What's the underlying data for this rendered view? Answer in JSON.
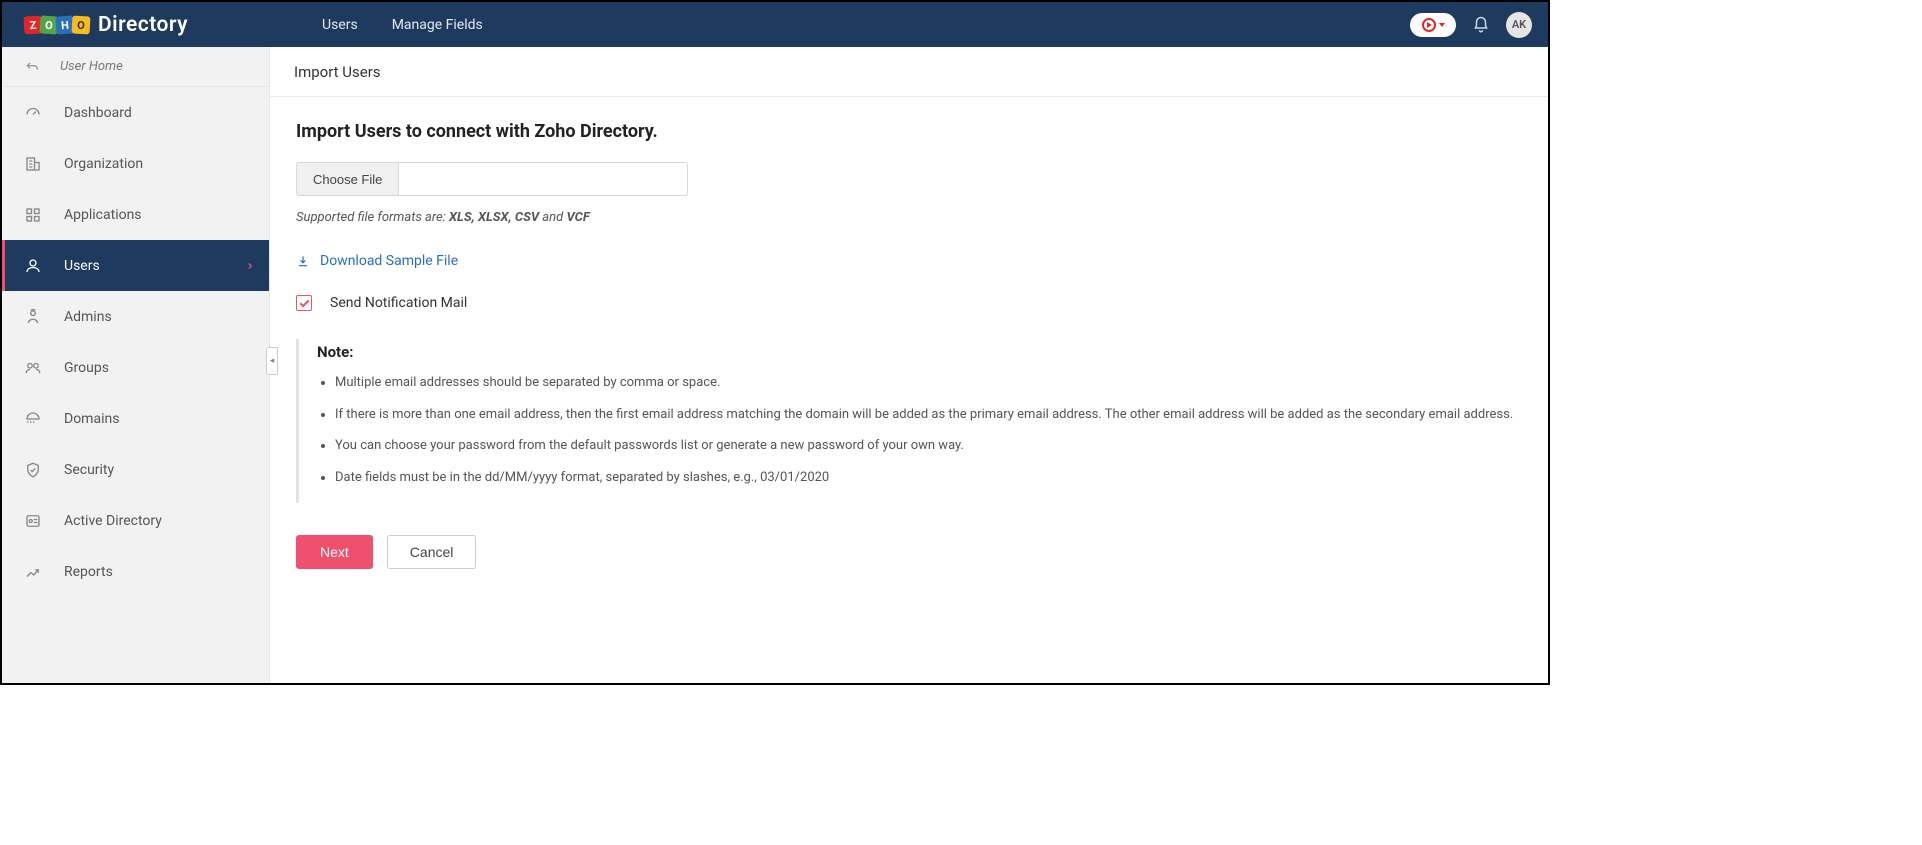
{
  "app_name": "Directory",
  "logo_letters": [
    "Z",
    "O",
    "H",
    "O"
  ],
  "topnav": {
    "users": "Users",
    "manage_fields": "Manage Fields"
  },
  "avatar_initials": "AK",
  "sidebar": {
    "user_home": "User Home",
    "items": [
      {
        "label": "Dashboard"
      },
      {
        "label": "Organization"
      },
      {
        "label": "Applications"
      },
      {
        "label": "Users"
      },
      {
        "label": "Admins"
      },
      {
        "label": "Groups"
      },
      {
        "label": "Domains"
      },
      {
        "label": "Security"
      },
      {
        "label": "Active Directory"
      },
      {
        "label": "Reports"
      }
    ]
  },
  "content": {
    "breadcrumb": "Import Users",
    "title": "Import Users to connect with Zoho Directory.",
    "choose_file": "Choose File",
    "hint_prefix": "Supported file formats are: ",
    "hint_formats": "XLS, XLSX, CSV",
    "hint_and": " and ",
    "hint_last": "VCF",
    "download_link": "Download Sample File",
    "notify_label": "Send Notification Mail",
    "note_title": "Note:",
    "notes": [
      "Multiple email addresses should be separated by comma or space.",
      "If there is more than one email address, then the first email address matching the domain will be added as the primary email address. The other email address will be added as the secondary email address.",
      "You can choose your password from the default passwords list or generate a new password of your own way.",
      "Date fields must be in the dd/MM/yyyy format, separated by slashes, e.g., 03/01/2020"
    ],
    "next": "Next",
    "cancel": "Cancel"
  }
}
